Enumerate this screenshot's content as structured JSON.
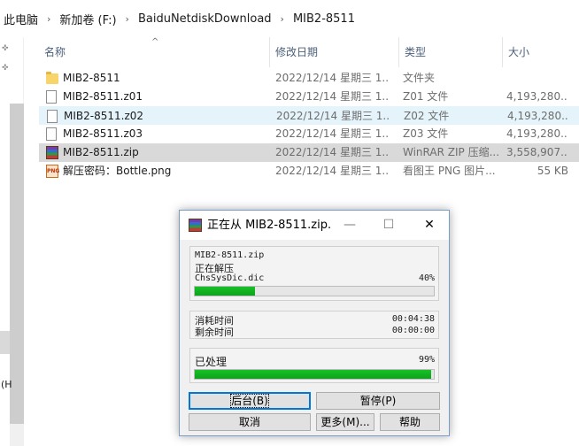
{
  "breadcrumb": [
    "此电脑",
    "新加卷 (F:)",
    "BaiduNetdiskDownload",
    "MIB2-8511"
  ],
  "breadcrumb_separator": "›",
  "nav": {
    "pin_icon_glyph": "✜",
    "text_fragment": "(H"
  },
  "columns": {
    "name": "名称",
    "date": "修改日期",
    "type": "类型",
    "size": "大小",
    "sort_glyph": "^"
  },
  "files": [
    {
      "icon": "folder-icon",
      "name": "MIB2-8511",
      "date": "2022/12/14 星期三 1...",
      "type": "文件夹",
      "size": ""
    },
    {
      "icon": "file-icon",
      "name": "MIB2-8511.z01",
      "date": "2022/12/14 星期三 1...",
      "type": "Z01 文件",
      "size": "4,193,280..."
    },
    {
      "icon": "file-icon",
      "name": "MIB2-8511.z02",
      "date": "2022/12/14 星期三 1...",
      "type": "Z02 文件",
      "size": "4,193,280..."
    },
    {
      "icon": "file-icon",
      "name": "MIB2-8511.z03",
      "date": "2022/12/14 星期三 1...",
      "type": "Z03 文件",
      "size": "4,193,280..."
    },
    {
      "icon": "winrar-icon",
      "name": "MIB2-8511.zip",
      "date": "2022/12/14 星期三 1...",
      "type": "WinRAR ZIP 压缩...",
      "size": "3,558,907..."
    },
    {
      "icon": "png-icon",
      "name": "解压密码：Bottle.png",
      "date": "2022/12/14 星期三 1...",
      "type": "看图王 PNG 图片...",
      "size": "55 KB"
    }
  ],
  "png_icon_text": "PNG",
  "dialog": {
    "title": "正在从 MIB2-8511.zip...",
    "minimize_glyph": "—",
    "maximize_glyph": "☐",
    "close_glyph": "✕",
    "archive": "MIB2-8511.zip",
    "status": "正在解压",
    "current_file": "ChsSysDic.dic",
    "file_percent_label": "40%",
    "file_progress": 0.25,
    "elapsed_label": "消耗时间",
    "elapsed": "00:04:38",
    "remaining_label": "剩余时间",
    "remaining": "00:00:00",
    "processed_label": "已处理",
    "processed_percent_label": "99%",
    "total_progress": 0.99,
    "buttons": {
      "background": "后台(B)",
      "pause": "暂停(P)",
      "cancel": "取消",
      "more": "更多(M)...",
      "help": "帮助"
    }
  },
  "colors": {
    "header_text": "#4c607a",
    "progress_green": "#16c126",
    "hover_row": "#e5f3fb",
    "selected_row": "#d9d9d9"
  }
}
